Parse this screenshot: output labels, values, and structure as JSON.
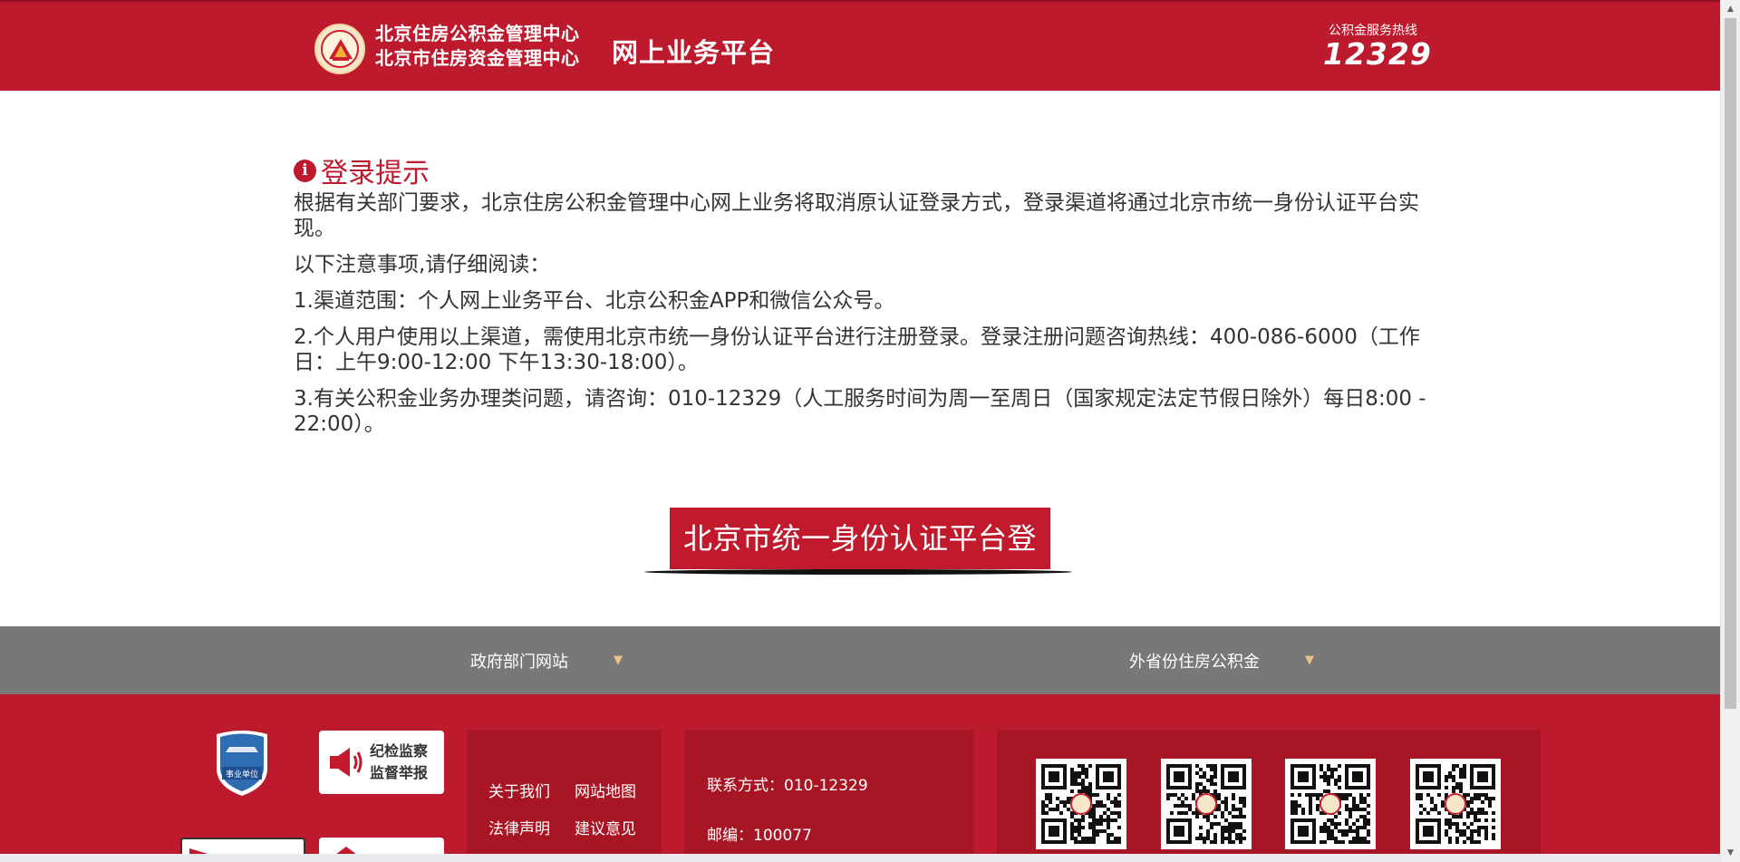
{
  "header": {
    "org_name_1": "北京住房公积金管理中心",
    "org_name_2": "北京市住房资金管理中心",
    "platform_name": "网上业务平台",
    "hotline_label": "公积金服务热线",
    "hotline_number": "12329",
    "logo_icon": "housing-fund-emblem-icon"
  },
  "notice": {
    "title": "登录提示",
    "info_icon": "i",
    "intro": "根据有关部门要求，北京住房公积金管理中心网上业务将取消原认证登录方式，登录渠道将通过北京市统一身份认证平台实现。",
    "read_prompt": "以下注意事项,请仔细阅读：",
    "item1": "1.渠道范围：个人网上业务平台、北京公积金APP和微信公众号。",
    "item2": "2.个人用户使用以上渠道，需使用北京市统一身份认证平台进行注册登录。登录注册问题咨询热线：400-086-6000（工作日：上午9:00-12:00 下午13:30-18:00）。",
    "item3": "3.有关公积金业务办理类问题，请咨询：010-12329（人工服务时间为周一至周日（国家规定法定节假日除外）每日8:00 - 22:00）。"
  },
  "login": {
    "button_label": "北京市统一身份认证平台登录"
  },
  "linkbar": {
    "gov_sites": "政府部门网站",
    "other_provinces": "外省份住房公积金",
    "caret": "▼"
  },
  "footer": {
    "report_label_1": "纪检监察",
    "report_label_2": "监督举报",
    "links": {
      "about": "关于我们",
      "sitemap": "网站地图",
      "legal": "法律声明",
      "advice": "建议意见"
    },
    "contact": "联系方式：010-12329",
    "zipcode": "邮编：100077",
    "badge_text": "事业单位"
  },
  "colors": {
    "brand_red": "#bd1a2d",
    "footer_panel": "#a81524",
    "linkbar_gray": "#787878"
  }
}
